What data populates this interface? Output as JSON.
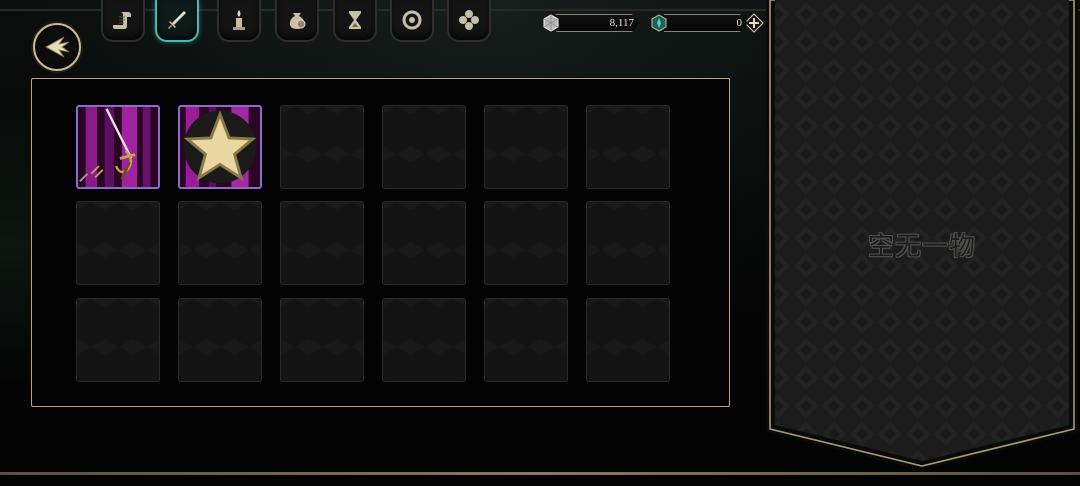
{
  "currency": {
    "silver": {
      "icon": "silver-gem-icon",
      "value": "8,117"
    },
    "crystal": {
      "icon": "teal-crystal-icon",
      "value": "0"
    }
  },
  "tabs": [
    {
      "id": "scroll",
      "icon": "scroll-icon",
      "active": false
    },
    {
      "id": "weapon",
      "icon": "sword-icon",
      "active": true
    },
    {
      "id": "candle",
      "icon": "candle-icon",
      "active": false
    },
    {
      "id": "pouch",
      "icon": "coin-pouch-icon",
      "active": false
    },
    {
      "id": "hourglass",
      "icon": "hourglass-icon",
      "active": false
    },
    {
      "id": "ring",
      "icon": "ring-icon",
      "active": false
    },
    {
      "id": "clover",
      "icon": "clover-icon",
      "active": false
    }
  ],
  "inventory": {
    "columns": 6,
    "rows": 3,
    "items": [
      {
        "slot": 0,
        "icon": "rapier-icon",
        "starred": false
      },
      {
        "slot": 1,
        "icon": "dice-flail-icon",
        "starred": true
      }
    ]
  },
  "detail": {
    "empty_text": "空无一物"
  },
  "colors": {
    "gold_border": "#b2a47f",
    "active_tab": "#4bb9b3",
    "item_frame": "#8d6cc8",
    "item_bg": "#26051f"
  }
}
